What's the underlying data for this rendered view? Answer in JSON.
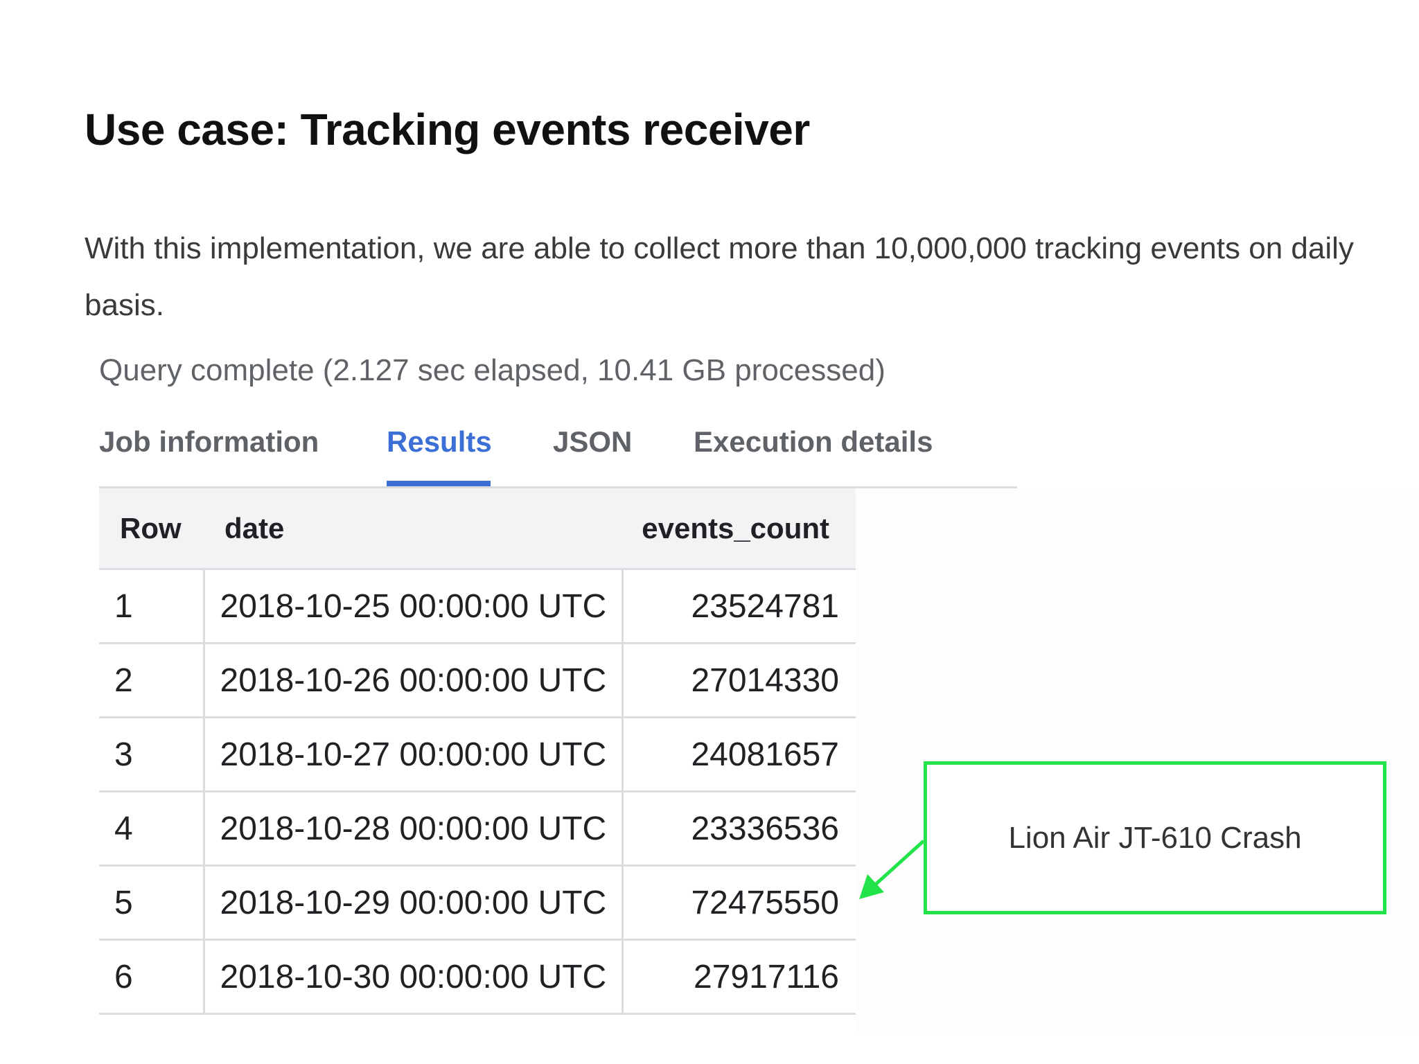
{
  "page": {
    "title": "Use case: Tracking events receiver",
    "paragraph": "With this implementation, we are able to collect more than 10,000,000 tracking events on daily basis."
  },
  "query": {
    "status": "Query complete (2.127 sec elapsed, 10.41 GB processed)"
  },
  "tabs": [
    {
      "label": "Job information",
      "active": false
    },
    {
      "label": "Results",
      "active": true
    },
    {
      "label": "JSON",
      "active": false
    },
    {
      "label": "Execution details",
      "active": false
    }
  ],
  "table": {
    "headers": [
      "Row",
      "date",
      "events_count"
    ],
    "rows": [
      {
        "row": "1",
        "date": "2018-10-25 00:00:00 UTC",
        "events_count": "23524781"
      },
      {
        "row": "2",
        "date": "2018-10-26 00:00:00 UTC",
        "events_count": "27014330"
      },
      {
        "row": "3",
        "date": "2018-10-27 00:00:00 UTC",
        "events_count": "24081657"
      },
      {
        "row": "4",
        "date": "2018-10-28 00:00:00 UTC",
        "events_count": "23336536"
      },
      {
        "row": "5",
        "date": "2018-10-29 00:00:00 UTC",
        "events_count": "72475550"
      },
      {
        "row": "6",
        "date": "2018-10-30 00:00:00 UTC",
        "events_count": "27917116"
      }
    ]
  },
  "annotation": {
    "text": "Lion Air JT-610 Crash",
    "border_color": "#22e34a",
    "points_to_row": 5
  },
  "colors": {
    "accent": "#3c6fd6",
    "annotation": "#22e34a"
  }
}
